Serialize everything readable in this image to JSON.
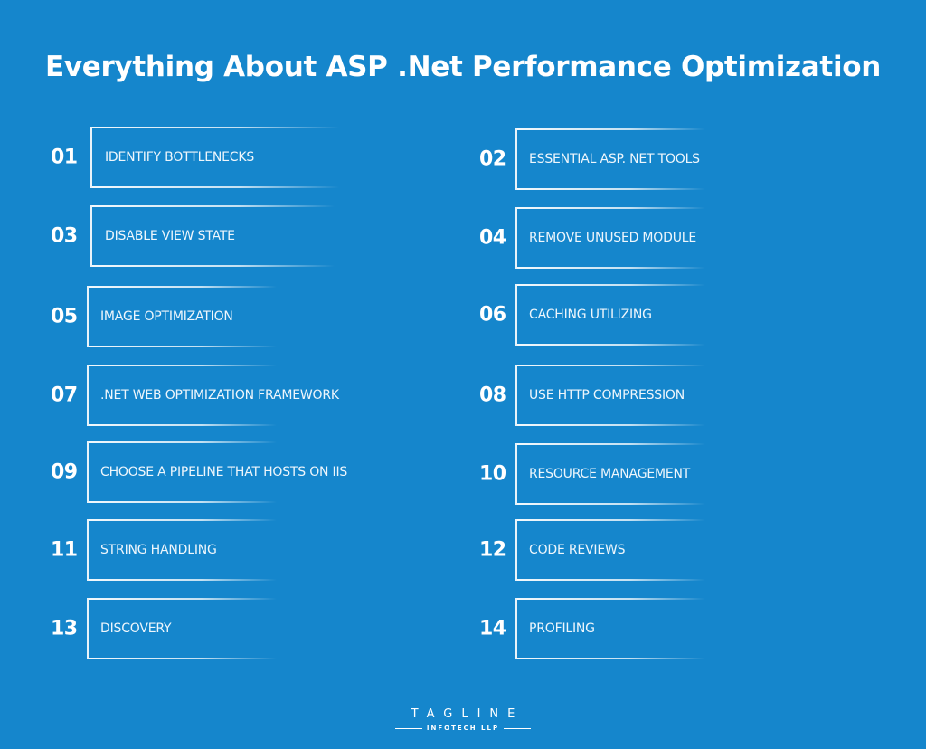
{
  "title": "Everything About ASP .Net Performance Optimization",
  "items": [
    {
      "number": "01",
      "label": "IDENTIFY BOTTLENECKS"
    },
    {
      "number": "02",
      "label": "ESSENTIAL ASP. NET TOOLS"
    },
    {
      "number": "03",
      "label": "DISABLE VIEW STATE"
    },
    {
      "number": "04",
      "label": "REMOVE UNUSED MODULE"
    },
    {
      "number": "05",
      "label": "IMAGE OPTIMIZATION"
    },
    {
      "number": "06",
      "label": "CACHING UTILIZING"
    },
    {
      "number": "07",
      "label": ".NET WEB OPTIMIZATION FRAMEWORK"
    },
    {
      "number": "08",
      "label": "USE HTTP COMPRESSION"
    },
    {
      "number": "09",
      "label": "CHOOSE A PIPELINE THAT HOSTS ON IIS"
    },
    {
      "number": "10",
      "label": "RESOURCE MANAGEMENT"
    },
    {
      "number": "11",
      "label": "STRING HANDLING"
    },
    {
      "number": "12",
      "label": "CODE REVIEWS"
    },
    {
      "number": "13",
      "label": "DISCOVERY"
    },
    {
      "number": "14",
      "label": "PROFILING"
    }
  ],
  "logo": {
    "name": "TAGLINE",
    "subtitle": "INFOTECH LLP"
  },
  "colors": {
    "background": "#1586cc",
    "text": "#ffffff"
  }
}
